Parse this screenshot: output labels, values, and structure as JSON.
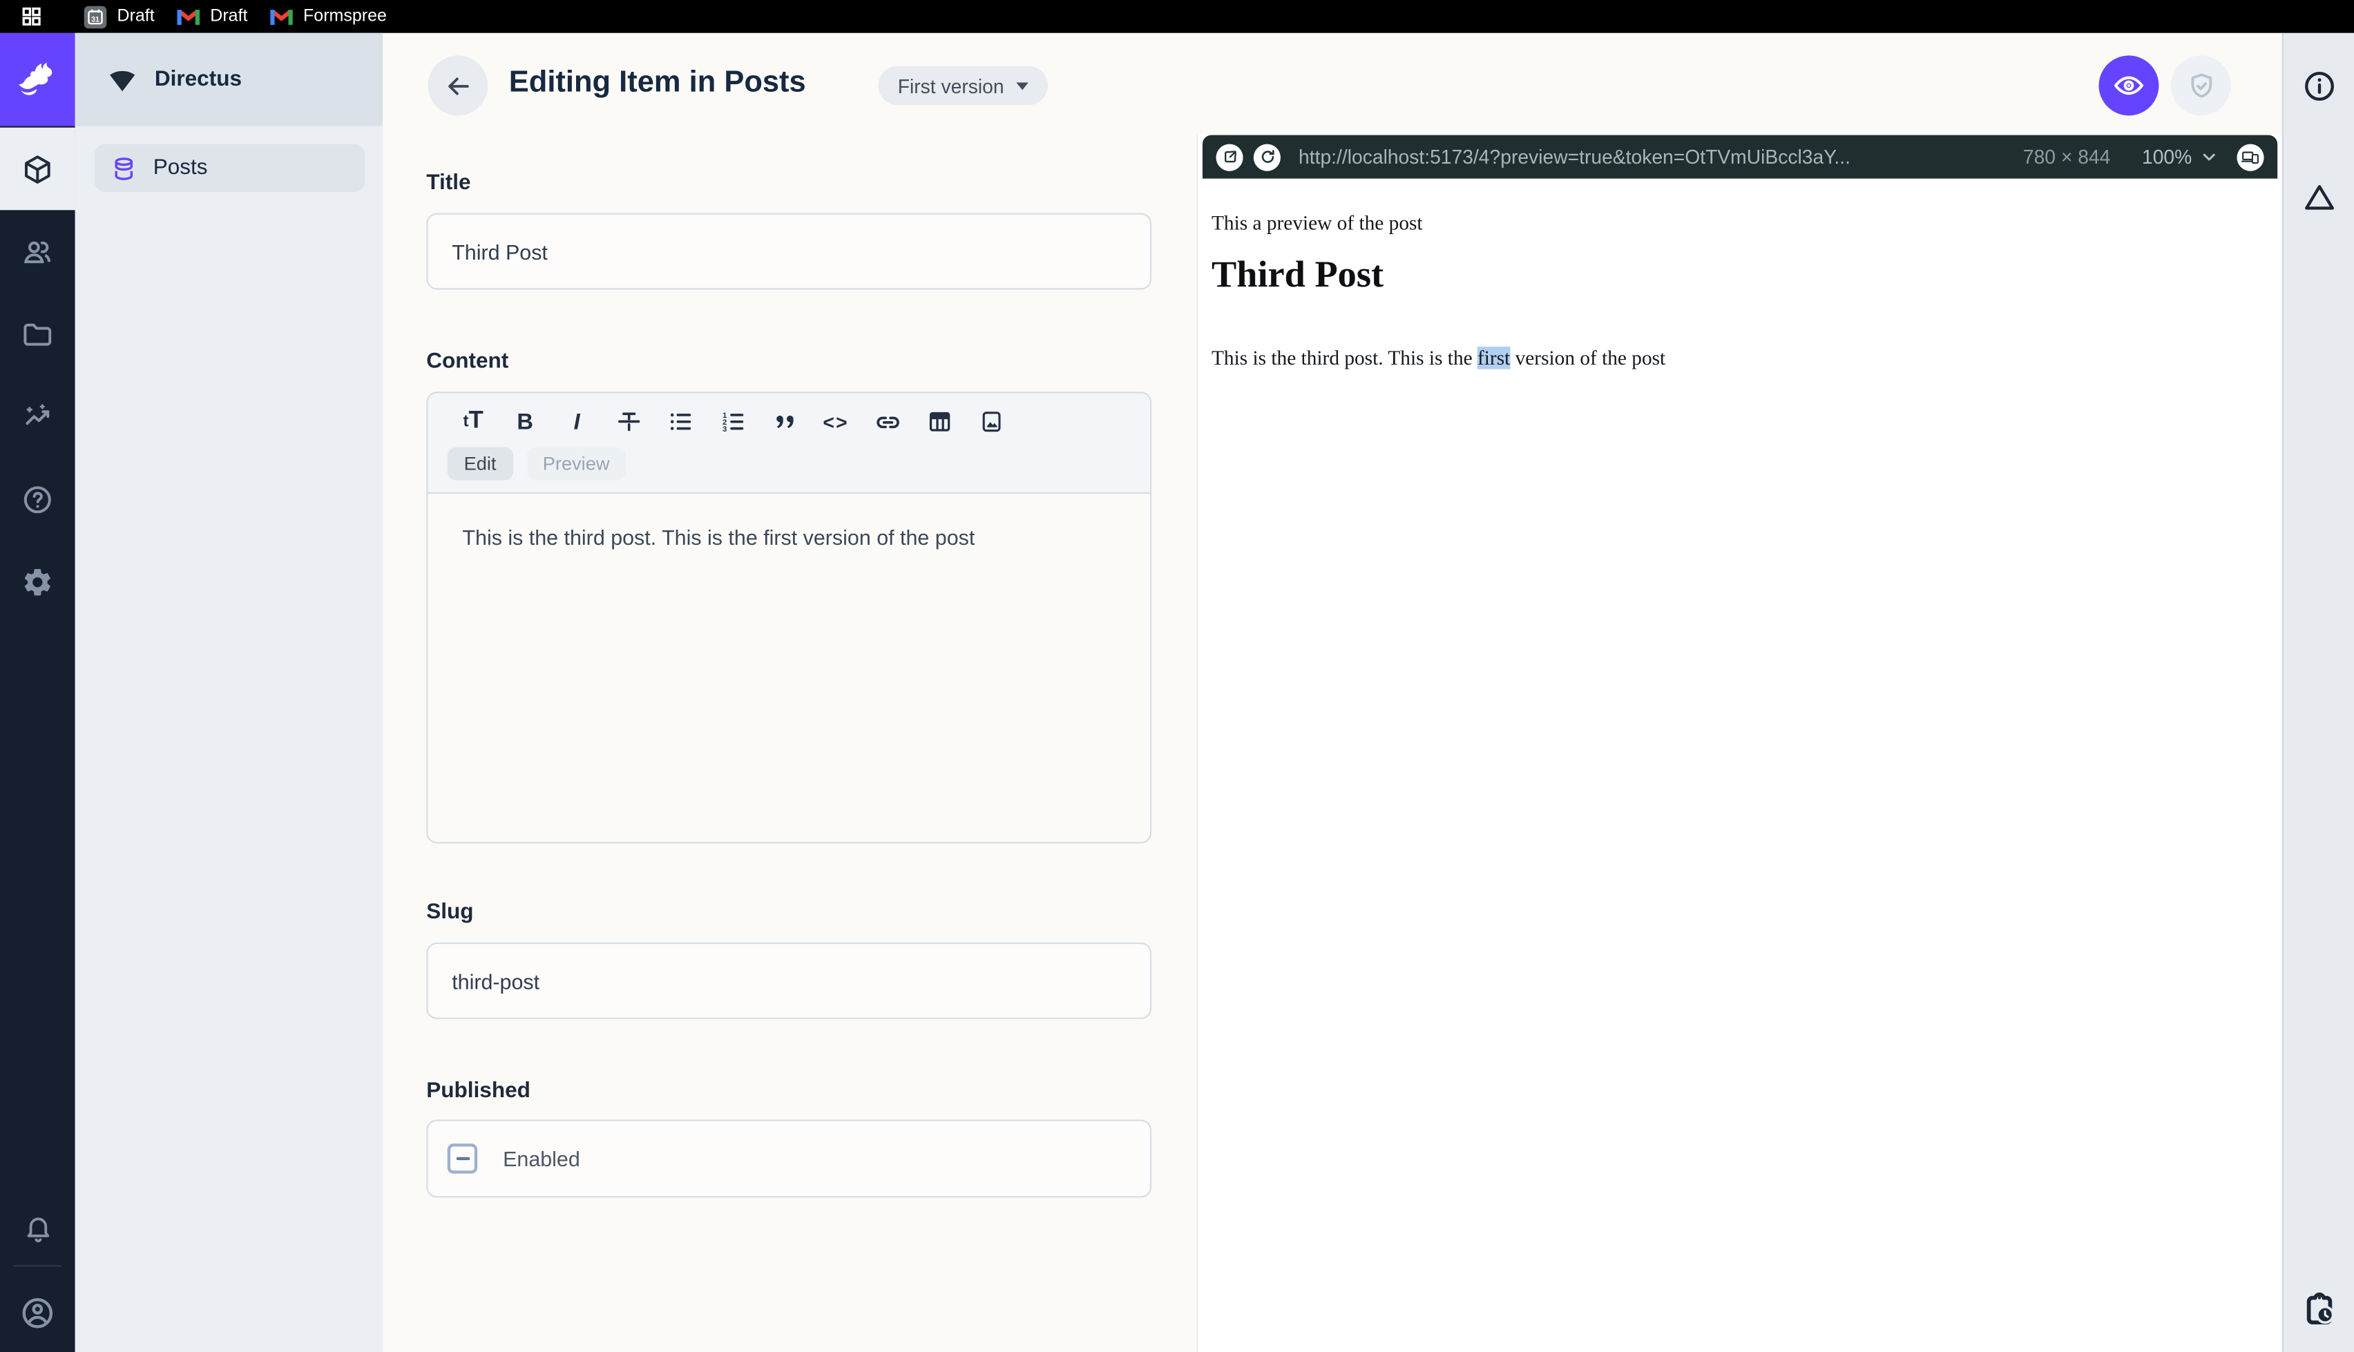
{
  "browser": {
    "calendar_day": "31",
    "tabs": [
      {
        "label": "Draft"
      },
      {
        "label": "Draft"
      },
      {
        "label": "Formspree"
      }
    ]
  },
  "nav": {
    "project_name": "Directus",
    "items": [
      {
        "label": "Posts"
      }
    ]
  },
  "header": {
    "title": "Editing Item in Posts",
    "version_label": "First version"
  },
  "form": {
    "title": {
      "label": "Title",
      "value": "Third Post"
    },
    "content": {
      "label": "Content",
      "tab_edit": "Edit",
      "tab_preview": "Preview",
      "value": "This is the third post. This is the first version of the post"
    },
    "slug": {
      "label": "Slug",
      "value": "third-post"
    },
    "published": {
      "label": "Published",
      "checkbox_label": "Enabled"
    }
  },
  "editor_glyphs": {
    "text_size_small": "t",
    "text_size_large": "T",
    "bold": "B",
    "italic": "I",
    "code": "<>"
  },
  "preview": {
    "url": "http://localhost:5173/4?preview=true&token=OtTVmUiBccl3aY...",
    "dimensions": "780 × 844",
    "zoom": "100%",
    "content": {
      "intro": "This a preview of the post",
      "heading": "Third Post",
      "body_before": "This is the third post. This is the ",
      "body_highlight": "first",
      "body_after": " version of the post"
    }
  },
  "colors": {
    "accent": "#6644ff",
    "module_bar": "#161f2e",
    "preview_toolbar": "#212e30",
    "selection_highlight": "#b0cff1"
  }
}
